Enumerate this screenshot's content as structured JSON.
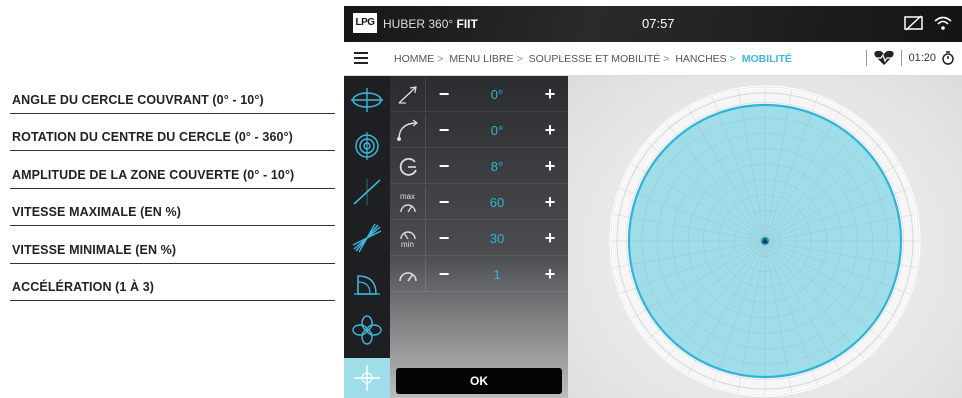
{
  "legend": [
    "ANGLE DU CERCLE COUVRANT (0° - 10°)",
    "ROTATION DU CENTRE DU CERCLE (0° - 360°)",
    "AMPLITUDE DE LA ZONE COUVERTE (0° - 10°)",
    "VITESSE MAXIMALE (EN %)",
    "VITESSE MINIMALE (EN %)",
    "ACCÉLÉRATION (1 À 3)"
  ],
  "header": {
    "logo": "LPG",
    "brand_prefix": "HUBER 360°",
    "brand_bold": "FIIT",
    "time": "07:57",
    "icons": [
      "screen-cast-off-icon",
      "wifi-icon"
    ]
  },
  "breadcrumb": {
    "items": [
      "HOMME",
      "MENU LIBRE",
      "SOUPLESSE ET MOBILITÉ",
      "HANCHES"
    ],
    "active": "MOBILITÉ",
    "separator": ">"
  },
  "status": {
    "timer": "01:20",
    "icons": [
      "heart-icon",
      "stopwatch-icon"
    ]
  },
  "params": [
    {
      "name": "angle",
      "value": "0°"
    },
    {
      "name": "rotation",
      "value": "0°"
    },
    {
      "name": "amplitude",
      "value": "8°"
    },
    {
      "name": "max-speed",
      "label": "max",
      "value": "60"
    },
    {
      "name": "min-speed",
      "label": "min",
      "value": "30"
    },
    {
      "name": "acceleration",
      "value": "1"
    }
  ],
  "controls": {
    "minus": "−",
    "plus": "+",
    "ok": "OK"
  },
  "colors": {
    "accent": "#3fb7d6",
    "zone_fill": "#9fdde9",
    "zone_stroke": "#2fb4d8"
  }
}
